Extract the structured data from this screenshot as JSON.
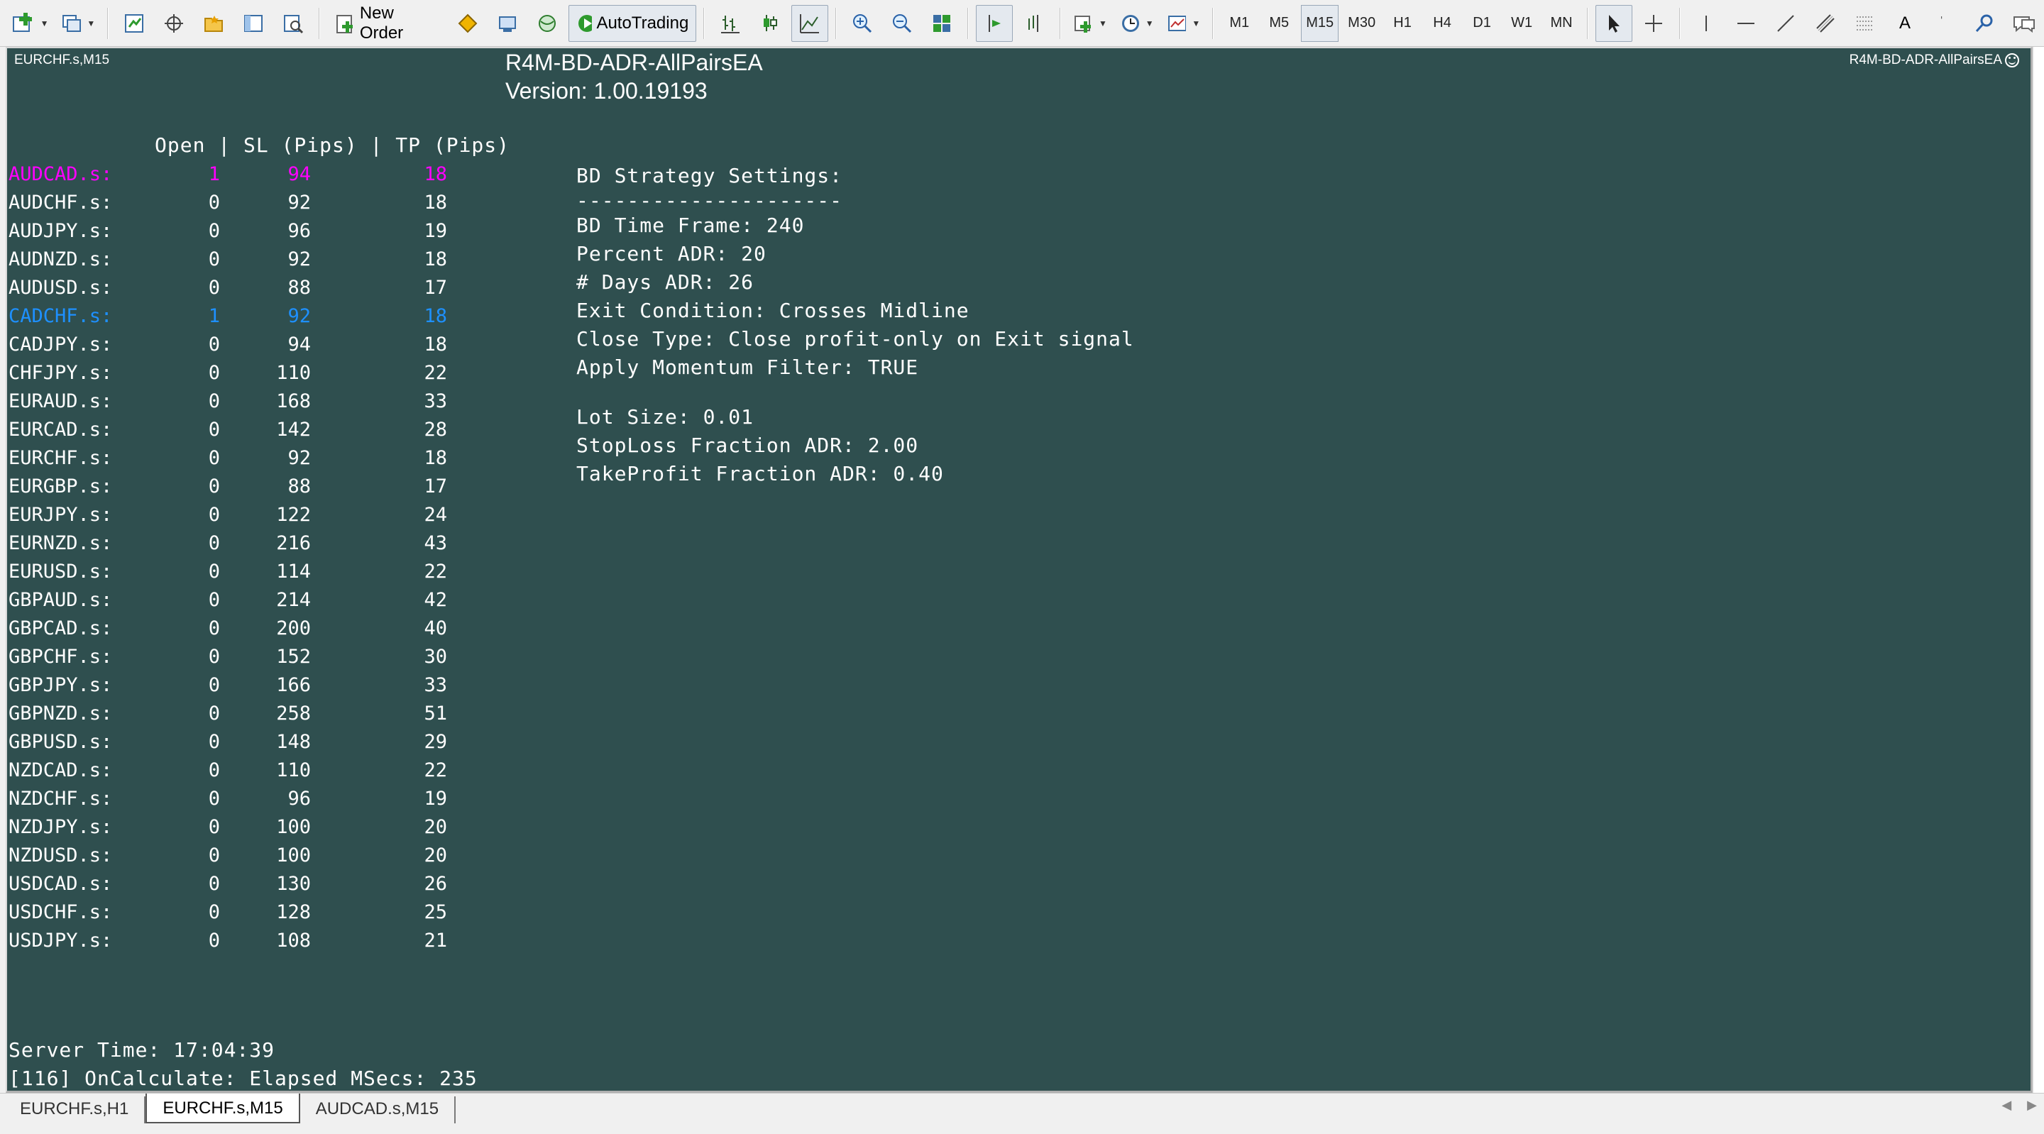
{
  "toolbar": {
    "new_order_label": "New Order",
    "autotrading_label": "AutoTrading",
    "timeframes": [
      "M1",
      "M5",
      "M15",
      "M30",
      "H1",
      "H4",
      "D1",
      "W1",
      "MN"
    ],
    "active_timeframe": "M15",
    "text_tool_label": "A"
  },
  "chart": {
    "symbol_label": "EURCHF.s,M15",
    "ea_title": "R4M-BD-ADR-AllPairsEA",
    "ea_version": "Version: 1.00.19193",
    "ea_tag": "R4M-BD-ADR-AllPairsEA",
    "table_header": "Open | SL (Pips) | TP (Pips)",
    "pairs": [
      {
        "symbol": "AUDCAD.s:",
        "open": "1",
        "sl": "94",
        "tp": "18",
        "color": "#ff00ff"
      },
      {
        "symbol": "AUDCHF.s:",
        "open": "0",
        "sl": "92",
        "tp": "18",
        "color": "#ffffff"
      },
      {
        "symbol": "AUDJPY.s:",
        "open": "0",
        "sl": "96",
        "tp": "19",
        "color": "#ffffff"
      },
      {
        "symbol": "AUDNZD.s:",
        "open": "0",
        "sl": "92",
        "tp": "18",
        "color": "#ffffff"
      },
      {
        "symbol": "AUDUSD.s:",
        "open": "0",
        "sl": "88",
        "tp": "17",
        "color": "#ffffff"
      },
      {
        "symbol": "CADCHF.s:",
        "open": "1",
        "sl": "92",
        "tp": "18",
        "color": "#1e90ff"
      },
      {
        "symbol": "CADJPY.s:",
        "open": "0",
        "sl": "94",
        "tp": "18",
        "color": "#ffffff"
      },
      {
        "symbol": "CHFJPY.s:",
        "open": "0",
        "sl": "110",
        "tp": "22",
        "color": "#ffffff"
      },
      {
        "symbol": "EURAUD.s:",
        "open": "0",
        "sl": "168",
        "tp": "33",
        "color": "#ffffff"
      },
      {
        "symbol": "EURCAD.s:",
        "open": "0",
        "sl": "142",
        "tp": "28",
        "color": "#ffffff"
      },
      {
        "symbol": "EURCHF.s:",
        "open": "0",
        "sl": "92",
        "tp": "18",
        "color": "#ffffff"
      },
      {
        "symbol": "EURGBP.s:",
        "open": "0",
        "sl": "88",
        "tp": "17",
        "color": "#ffffff"
      },
      {
        "symbol": "EURJPY.s:",
        "open": "0",
        "sl": "122",
        "tp": "24",
        "color": "#ffffff"
      },
      {
        "symbol": "EURNZD.s:",
        "open": "0",
        "sl": "216",
        "tp": "43",
        "color": "#ffffff"
      },
      {
        "symbol": "EURUSD.s:",
        "open": "0",
        "sl": "114",
        "tp": "22",
        "color": "#ffffff"
      },
      {
        "symbol": "GBPAUD.s:",
        "open": "0",
        "sl": "214",
        "tp": "42",
        "color": "#ffffff"
      },
      {
        "symbol": "GBPCAD.s:",
        "open": "0",
        "sl": "200",
        "tp": "40",
        "color": "#ffffff"
      },
      {
        "symbol": "GBPCHF.s:",
        "open": "0",
        "sl": "152",
        "tp": "30",
        "color": "#ffffff"
      },
      {
        "symbol": "GBPJPY.s:",
        "open": "0",
        "sl": "166",
        "tp": "33",
        "color": "#ffffff"
      },
      {
        "symbol": "GBPNZD.s:",
        "open": "0",
        "sl": "258",
        "tp": "51",
        "color": "#ffffff"
      },
      {
        "symbol": "GBPUSD.s:",
        "open": "0",
        "sl": "148",
        "tp": "29",
        "color": "#ffffff"
      },
      {
        "symbol": "NZDCAD.s:",
        "open": "0",
        "sl": "110",
        "tp": "22",
        "color": "#ffffff"
      },
      {
        "symbol": "NZDCHF.s:",
        "open": "0",
        "sl": "96",
        "tp": "19",
        "color": "#ffffff"
      },
      {
        "symbol": "NZDJPY.s:",
        "open": "0",
        "sl": "100",
        "tp": "20",
        "color": "#ffffff"
      },
      {
        "symbol": "NZDUSD.s:",
        "open": "0",
        "sl": "100",
        "tp": "20",
        "color": "#ffffff"
      },
      {
        "symbol": "USDCAD.s:",
        "open": "0",
        "sl": "130",
        "tp": "26",
        "color": "#ffffff"
      },
      {
        "symbol": "USDCHF.s:",
        "open": "0",
        "sl": "128",
        "tp": "25",
        "color": "#ffffff"
      },
      {
        "symbol": "USDJPY.s:",
        "open": "0",
        "sl": "108",
        "tp": "21",
        "color": "#ffffff"
      }
    ],
    "settings": {
      "heading": "BD Strategy Settings:",
      "underline": "---------------------",
      "time_frame": "BD Time Frame: 240",
      "percent_adr": "Percent ADR: 20",
      "days_adr": "# Days ADR: 26",
      "exit_condition": "Exit Condition: Crosses Midline",
      "close_type": "Close Type: Close profit-only on Exit signal",
      "momentum_filter": "Apply Momentum Filter: TRUE",
      "lot_size": "Lot Size: 0.01",
      "stoploss_fraction": "StopLoss Fraction ADR: 2.00",
      "takeprofit_fraction": "TakeProfit Fraction ADR: 0.40"
    },
    "server_time": "Server Time: 17:04:39",
    "calc_line": "[116] OnCalculate: Elapsed MSecs: 235",
    "background_color": "#2f4f4f"
  },
  "tabs": [
    {
      "label": "EURCHF.s,H1",
      "active": false
    },
    {
      "label": "EURCHF.s,M15",
      "active": true
    },
    {
      "label": "AUDCAD.s,M15",
      "active": false
    }
  ]
}
